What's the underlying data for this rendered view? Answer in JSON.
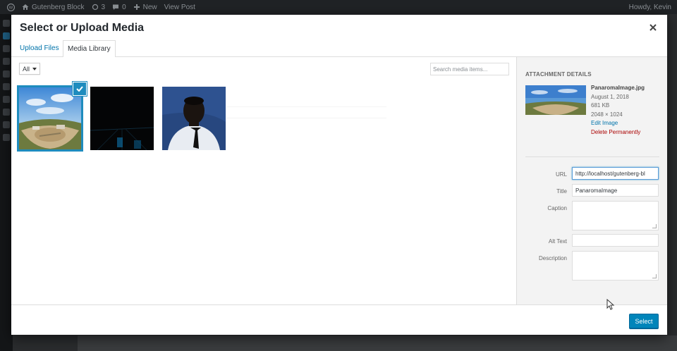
{
  "admin_bar": {
    "site_name": "Gutenberg Block",
    "updates_count": "3",
    "comments_count": "0",
    "new_label": "New",
    "view_post_label": "View Post",
    "howdy": "Howdy, Kevin"
  },
  "modal": {
    "title": "Select or Upload Media",
    "tabs": [
      {
        "label": "Upload Files"
      },
      {
        "label": "Media Library"
      }
    ],
    "filter_value": "All",
    "search_placeholder": "Search media items...",
    "select_button": "Select"
  },
  "attachment": {
    "heading": "ATTACHMENT DETAILS",
    "filename": "PanaromaImage.jpg",
    "date": "August 1, 2018",
    "size": "681 KB",
    "dimensions": "2048 × 1024",
    "edit_link": "Edit Image",
    "delete_link": "Delete Permanently",
    "fields": {
      "url_label": "URL",
      "url_value": "http://localhost/gutenberg-bl",
      "title_label": "Title",
      "title_value": "PanaromaImage",
      "caption_label": "Caption",
      "alt_label": "Alt Text",
      "description_label": "Description"
    }
  },
  "colors": {
    "accent": "#0073aa",
    "primary_button": "#0085ba",
    "selected_outline": "#1e8cbe",
    "delete": "#a00000"
  }
}
